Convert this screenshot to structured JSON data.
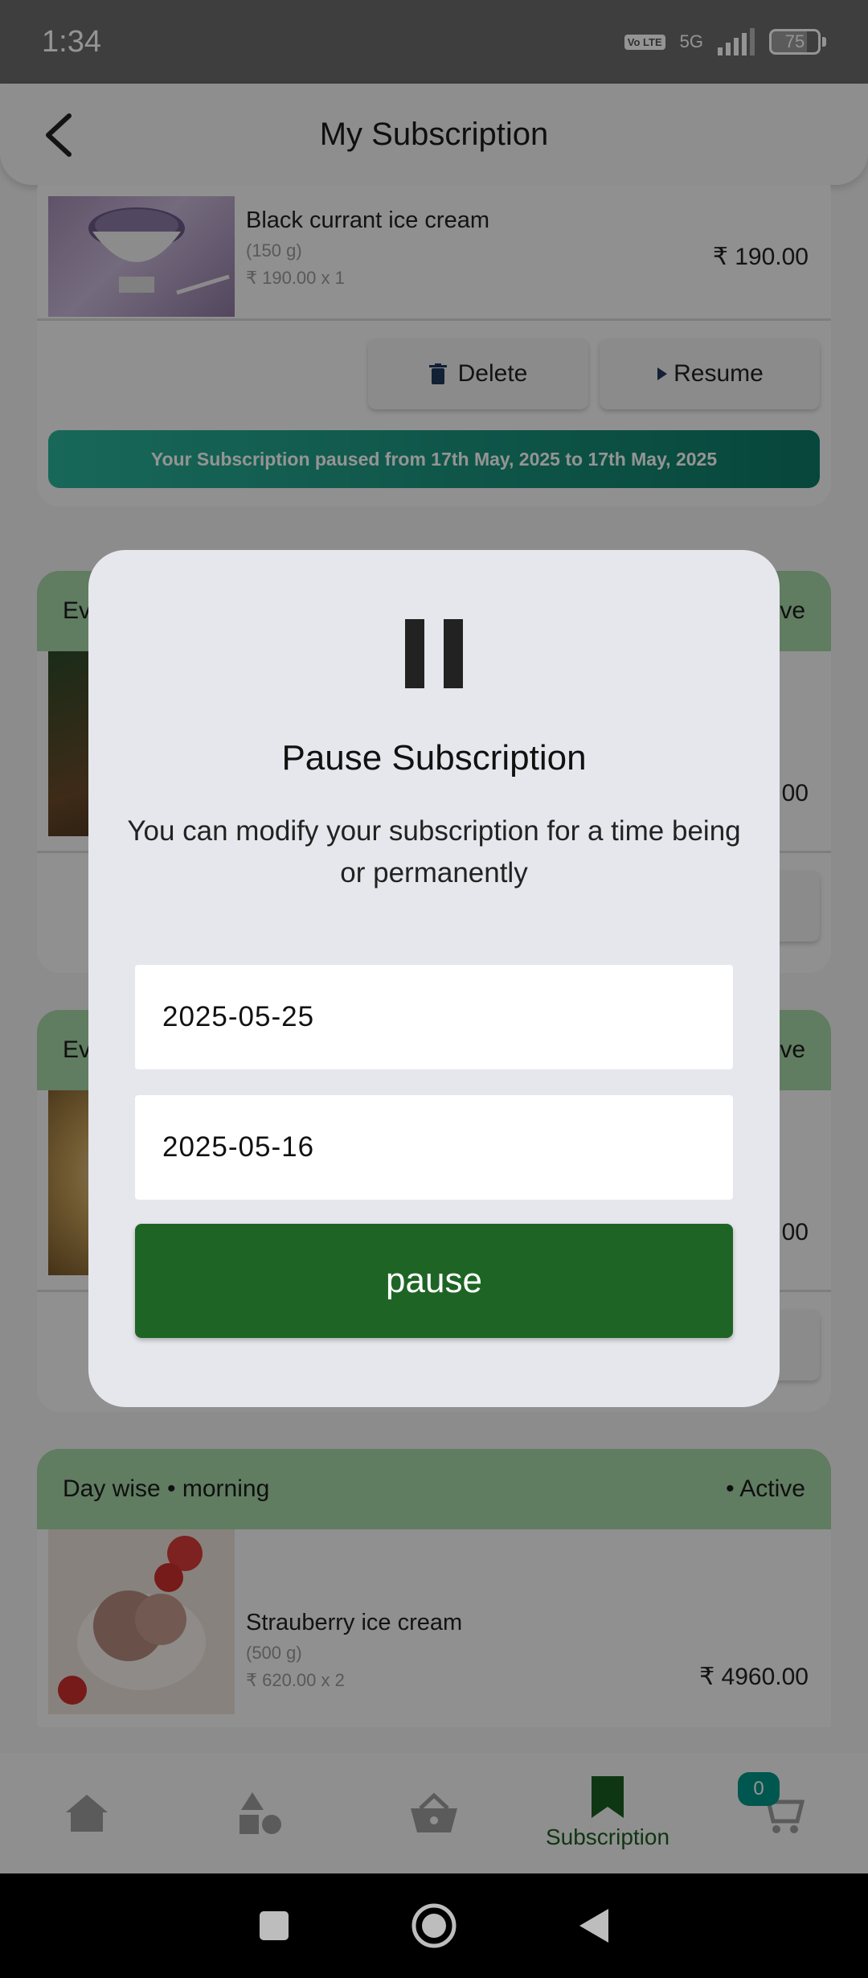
{
  "status_bar": {
    "time": "1:34",
    "network": "5G",
    "volte": "Vo LTE",
    "battery": "75",
    "battery_level": 0.75
  },
  "header": {
    "title": "My Subscription"
  },
  "cards": [
    {
      "item_name": "Black currant ice cream",
      "weight": "(150 g)",
      "qty_line": "₹ 190.00 x 1",
      "price": "₹ 190.00",
      "delete_label": "Delete",
      "resume_label": "Resume",
      "paused_message": "Your Subscription paused from 17th May, 2025 to 17th May, 2025"
    },
    {
      "type_label": "Ev",
      "status_label": "ve",
      "price_fragment": "00"
    },
    {
      "type_label": "Ev",
      "status_label": "ve",
      "price_fragment": "00"
    },
    {
      "type_label": "Day wise • morning",
      "status_label": "• Active",
      "item_name": "Strauberry ice cream",
      "weight": "(500 g)",
      "qty_line": "₹ 620.00 x 2",
      "price": "₹ 4960.00"
    }
  ],
  "dialog": {
    "title": "Pause Subscription",
    "message": "You can modify your subscription for a time being or permanently",
    "start_date": "2025-05-25",
    "end_date": "2025-05-16",
    "button_label": "pause"
  },
  "bottom_nav": {
    "items": [
      {
        "icon": "home-icon"
      },
      {
        "icon": "categories-icon"
      },
      {
        "icon": "basket-icon"
      },
      {
        "icon": "bookmark-icon",
        "label": "Subscription"
      },
      {
        "icon": "cart-icon",
        "badge": "0"
      }
    ],
    "active_color": "#1b5e20"
  },
  "colors": {
    "accent": "#1e6525",
    "card_header": "#a5d6a7",
    "badge": "#009688"
  }
}
